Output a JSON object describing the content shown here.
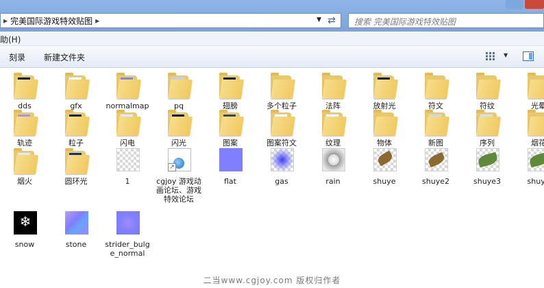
{
  "address": {
    "path": "完美国际游戏特效贴图"
  },
  "search": {
    "placeholder": "搜索 完美国际游戏特效贴图"
  },
  "menubar": {
    "help_fragment": "助(H)"
  },
  "toolbar": {
    "burn": "刻录",
    "new_folder": "新建文件夹"
  },
  "row1": [
    {
      "label": "dds",
      "icon": "folder-icon"
    },
    {
      "label": "gfx",
      "icon": "folder-icon"
    },
    {
      "label": "normalmap",
      "icon": "folder-icon"
    },
    {
      "label": "pq",
      "icon": "folder-icon"
    },
    {
      "label": "翅膀",
      "icon": "folder-icon"
    },
    {
      "label": "多个粒子",
      "icon": "folder-icon"
    },
    {
      "label": "法阵",
      "icon": "folder-icon"
    },
    {
      "label": "放射光",
      "icon": "folder-icon"
    },
    {
      "label": "符文",
      "icon": "folder-icon"
    },
    {
      "label": "符纹",
      "icon": "folder-icon"
    },
    {
      "label": "光晕",
      "icon": "folder-icon"
    }
  ],
  "row2": [
    {
      "label": "轨迹",
      "icon": "folder-icon"
    },
    {
      "label": "粒子",
      "icon": "folder-icon"
    },
    {
      "label": "闪电",
      "icon": "folder-icon"
    },
    {
      "label": "闪光",
      "icon": "folder-icon"
    },
    {
      "label": "图案",
      "icon": "folder-icon"
    },
    {
      "label": "图案符文",
      "icon": "folder-icon"
    },
    {
      "label": "纹理",
      "icon": "folder-icon"
    },
    {
      "label": "物体",
      "icon": "folder-icon"
    },
    {
      "label": "新图",
      "icon": "folder-icon"
    },
    {
      "label": "序列",
      "icon": "folder-icon"
    },
    {
      "label": "烟花",
      "icon": "folder-icon"
    }
  ],
  "row3": [
    {
      "label": "烟火",
      "icon": "folder-icon"
    },
    {
      "label": "圆环光",
      "icon": "folder-icon"
    },
    {
      "label": "1",
      "icon": "transparent-image-icon"
    },
    {
      "label": "cgjoy 游戏动画论坛、游戏特效论坛",
      "icon": "shortcut-icon"
    },
    {
      "label": "flat",
      "icon": "image-icon"
    },
    {
      "label": "gas",
      "icon": "image-icon"
    },
    {
      "label": "rain",
      "icon": "image-icon"
    },
    {
      "label": "shuye",
      "icon": "leaf-image-icon"
    },
    {
      "label": "shuye2",
      "icon": "leaf-image-icon"
    },
    {
      "label": "shuye3",
      "icon": "leaf-image-icon"
    },
    {
      "label": "shuye",
      "icon": "leaf-image-icon"
    }
  ],
  "row4": [
    {
      "label": "snow",
      "icon": "image-icon"
    },
    {
      "label": "stone",
      "icon": "image-icon"
    },
    {
      "label": "strider_bulge_normal",
      "icon": "image-icon"
    }
  ],
  "watermark": "二当www.cgjoy.com 版权归作者"
}
